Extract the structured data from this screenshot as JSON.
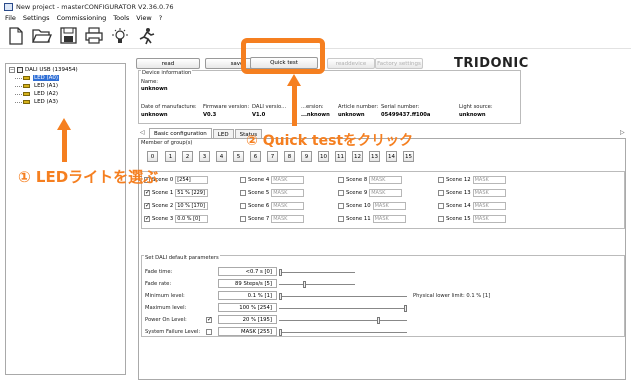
{
  "window": {
    "title": "New project - masterCONFIGURATOR V2.36.0.76"
  },
  "menu": [
    "File",
    "Settings",
    "Commissioning",
    "Tools",
    "View",
    "?"
  ],
  "toolbar": {
    "icons": [
      "new-file-icon",
      "open-folder-icon",
      "save-icon",
      "print-icon",
      "light-bulb-icon",
      "run-icon"
    ]
  },
  "tree": {
    "root": "DALI USB (139454)",
    "items": [
      "LED (A0)",
      "LED (A1)",
      "LED (A2)",
      "LED (A3)"
    ],
    "selected_index": 0
  },
  "actions": {
    "read": "read",
    "save": "save",
    "quick_test": "Quick test",
    "readdevice": "readdevice",
    "factory_settings": "Factory settings",
    "brand": "TRIDONIC"
  },
  "device_info": {
    "legend": "Device information",
    "name_label": "Name:",
    "name_value": "unknown",
    "fields": [
      {
        "label": "Date of manufacture:",
        "value": "unknown"
      },
      {
        "label": "Firmware version:",
        "value": "V0.3"
      },
      {
        "label": "DALI versio...",
        "value": "V1.0"
      },
      {
        "label": "...ersion:",
        "value": "...nknown"
      },
      {
        "label": "Article number:",
        "value": "unknown"
      },
      {
        "label": "Serial number:",
        "value": "05499437.ff100a"
      },
      {
        "label": "Light source:",
        "value": "unknown"
      }
    ]
  },
  "tabs": [
    "Basic configuration",
    "LED",
    "Status"
  ],
  "active_tab": 0,
  "groups": {
    "legend": "Member of group(s)",
    "buttons": [
      "0",
      "1",
      "2",
      "3",
      "4",
      "5",
      "6",
      "7",
      "8",
      "9",
      "10",
      "11",
      "12",
      "13",
      "14",
      "15"
    ]
  },
  "scenes": [
    {
      "label": "Scene 0",
      "value": "[254]",
      "checked": false
    },
    {
      "label": "Scene 1",
      "value": "51 % [229]",
      "checked": true
    },
    {
      "label": "Scene 2",
      "value": "10 % [170]",
      "checked": true
    },
    {
      "label": "Scene 3",
      "value": "0.0 % [0]",
      "checked": true
    },
    {
      "label": "Scene 4",
      "value": "MASK",
      "checked": false
    },
    {
      "label": "Scene 5",
      "value": "MASK",
      "checked": false
    },
    {
      "label": "Scene 6",
      "value": "MASK",
      "checked": false
    },
    {
      "label": "Scene 7",
      "value": "MASK",
      "checked": false
    },
    {
      "label": "Scene 8",
      "value": "MASK",
      "checked": false
    },
    {
      "label": "Scene 9",
      "value": "MASK",
      "checked": false
    },
    {
      "label": "Scene 10",
      "value": "MASK",
      "checked": false
    },
    {
      "label": "Scene 11",
      "value": "MASK",
      "checked": false
    },
    {
      "label": "Scene 12",
      "value": "MASK",
      "checked": false
    },
    {
      "label": "Scene 13",
      "value": "MASK",
      "checked": false
    },
    {
      "label": "Scene 14",
      "value": "MASK",
      "checked": false
    },
    {
      "label": "Scene 15",
      "value": "MASK",
      "checked": false
    }
  ],
  "defaults": {
    "legend": "Set DALI default parameters",
    "rows": [
      {
        "label": "Fade time:",
        "value": "<0.7 s [0]",
        "slider": 0.0
      },
      {
        "label": "Fade rate:",
        "value": "89 Steps/s [5]",
        "slider": 0.33
      },
      {
        "label": "Minimum level:",
        "value": "0.1 % [1]",
        "slider": 0.0
      },
      {
        "label": "Maximum level:",
        "value": "100 % [254]",
        "slider": 1.0
      },
      {
        "label": "Power On Level:",
        "value": "20 % [195]",
        "slider": 0.77,
        "checkbox": true
      },
      {
        "label": "System Failure Level:",
        "value": "MASK [255]",
        "slider": 0.0,
        "checkbox": false
      }
    ],
    "physical_lower_limit": "Physical lower limit: 0.1 % [1]"
  },
  "annotations": {
    "step1": "① LEDライトを選ぶ",
    "step2": "② Quick testをクリック",
    "accent": "#f57f20"
  }
}
